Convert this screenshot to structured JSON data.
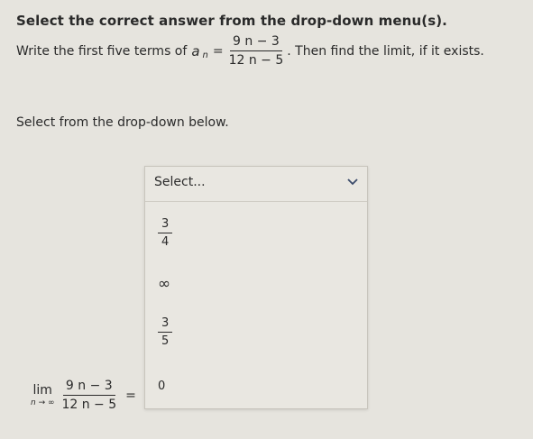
{
  "header": {
    "title": "Select the correct answer from the drop-down menu(s)."
  },
  "question": {
    "before": "Write the first five terms of",
    "var": "a",
    "sub": "n",
    "equals": "=",
    "numerator": "9 n − 3",
    "denominator": "12 n − 5",
    "after": ". Then find the limit, if it exists."
  },
  "instruction": "Select from the drop-down below.",
  "dropdown": {
    "selected": "Select...",
    "options": [
      {
        "numerator": "3",
        "denominator": "4"
      },
      {
        "label": "∞"
      },
      {
        "numerator": "3",
        "denominator": "5"
      },
      {
        "label": "0"
      }
    ]
  },
  "limit": {
    "lim": "lim",
    "sub": "n → ∞",
    "numerator": "9 n − 3",
    "denominator": "12 n − 5",
    "equals": "="
  }
}
